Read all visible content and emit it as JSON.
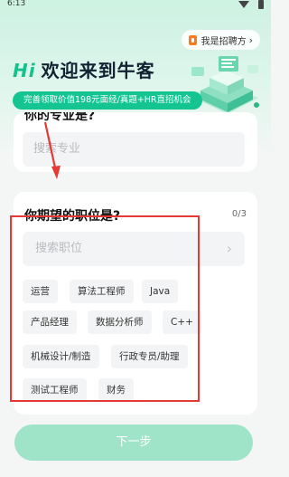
{
  "status_bar": {
    "time": "6:13"
  },
  "header": {
    "recruit_link": "我是招聘方",
    "title_hi": "Hi",
    "title_text": "欢迎来到牛客",
    "promo": "完善领取价值198元面经/真题+HR直招机会"
  },
  "major_card": {
    "title": "你的专业是?",
    "search_placeholder": "搜索专业"
  },
  "position_card": {
    "title": "你期望的职位是?",
    "counter": "0/3",
    "search_placeholder": "搜索职位",
    "chips": [
      "运营",
      "算法工程师",
      "Java",
      "产品经理",
      "数据分析师",
      "C++",
      "机械设计/制造",
      "行政专员/助理",
      "测试工程师",
      "财务"
    ]
  },
  "next_button": "下一步",
  "colors": {
    "accent": "#14c592",
    "annotation": "#e53935",
    "next_button_disabled": "#9fe3c9"
  }
}
